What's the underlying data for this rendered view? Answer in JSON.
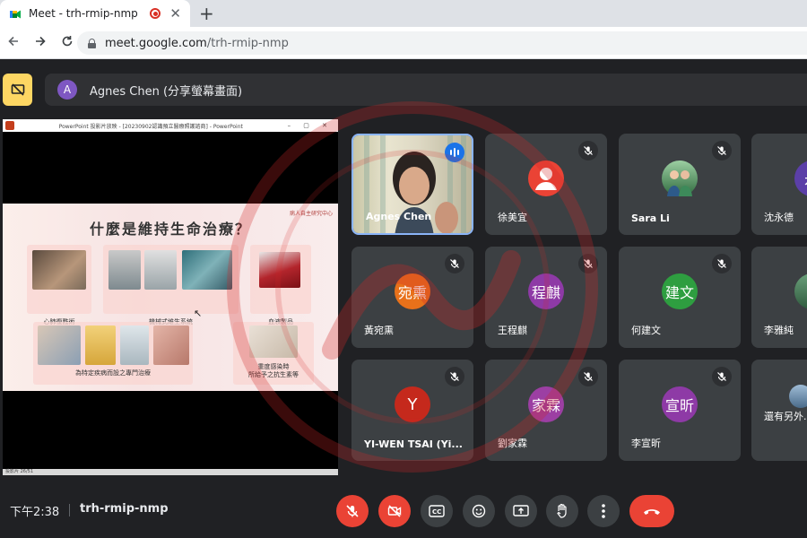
{
  "browser": {
    "tab_title": "Meet - trh-rmip-nmp",
    "new_tab_glyph": "+",
    "close_glyph": "✕",
    "url_host": "meet.google.com",
    "url_path": "/trh-rmip-nmp"
  },
  "banner": {
    "avatar_letter": "A",
    "presenter_text": "Agnes Chen (分享螢幕畫面)"
  },
  "shared_screen": {
    "app_title": "PowerPoint 投影片放映 - [20230902認識預立醫療照護諮商] - PowerPoint",
    "slide_title": "什麼是維持生命治療？",
    "slide_org": "病人自主研究中心",
    "captions": [
      "心肺復甦術",
      "機械式維生系統",
      "血液製品",
      "為特定疾病而設之專門治療",
      "重度感染時\n所給予之抗生素等"
    ],
    "status_text": "投影片 26/51"
  },
  "participants": [
    {
      "name": "Agnes Chen",
      "type": "video",
      "speaking": true
    },
    {
      "name": "徐美宜",
      "avatar_text": "",
      "avatar_color": "#ea4335",
      "icon": "default-person-icon",
      "muted": true
    },
    {
      "name": "Sara Li",
      "avatar_text": "",
      "avatar_color": "#3a7a4a",
      "icon": "photo-avatar",
      "muted": true
    },
    {
      "name": "沈永德",
      "avatar_text": "永",
      "avatar_color": "#5b3fa8",
      "muted": true
    },
    {
      "name": "黃宛熏",
      "avatar_text": "宛熏",
      "avatar_color": "#e8711a",
      "muted": true
    },
    {
      "name": "王程麒",
      "avatar_text": "程麒",
      "avatar_color": "#8e3aa6",
      "muted": true
    },
    {
      "name": "何建文",
      "avatar_text": "建文",
      "avatar_color": "#2e9e40",
      "muted": true
    },
    {
      "name": "李雅純",
      "avatar_text": "",
      "avatar_color": "#3f7d57",
      "icon": "photo-avatar",
      "muted": true
    },
    {
      "name": "YI-WEN TSAI (Yi...",
      "avatar_text": "Y",
      "avatar_color": "#c5291c",
      "muted": true
    },
    {
      "name": "劉家霖",
      "avatar_text": "家霖",
      "avatar_color": "#9c3fa3",
      "muted": true
    },
    {
      "name": "李宣昕",
      "avatar_text": "宣昕",
      "avatar_color": "#8e3aa6",
      "muted": true
    },
    {
      "name": "還有另外...",
      "avatar_text": "",
      "avatar_color": "#4a6b8a",
      "icon": "photo-avatar",
      "muted": false
    }
  ],
  "bottom_bar": {
    "time": "下午2:38",
    "meeting_code": "trh-rmip-nmp"
  },
  "colors": {
    "accent": "#8ab4f8",
    "danger": "#ea4335",
    "surface": "#3c4043",
    "background": "#202124"
  }
}
